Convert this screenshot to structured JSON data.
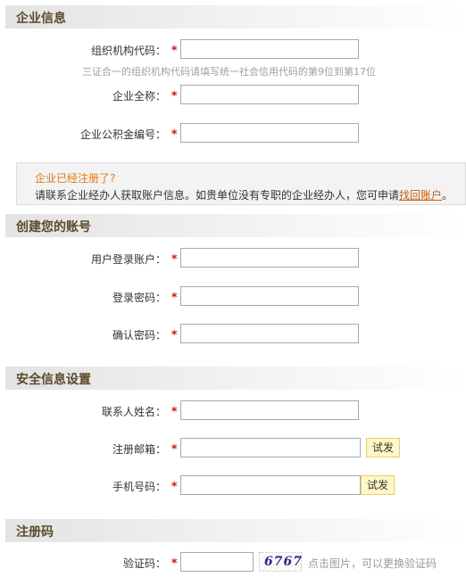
{
  "sections": {
    "company": "企业信息",
    "account": "创建您的账号",
    "security": "安全信息设置",
    "regcode": "注册码"
  },
  "fields": {
    "org_code": {
      "label": "组织机构代码：",
      "value": ""
    },
    "org_code_hint": "三证合一的组织机构代码请填写统一社会信用代码的第9位到第17位",
    "company_name": {
      "label": "企业全称：",
      "value": ""
    },
    "fund_number": {
      "label": "企业公积金编号：",
      "value": ""
    },
    "login_account": {
      "label": "用户登录账户：",
      "value": ""
    },
    "login_password": {
      "label": "登录密码：",
      "value": ""
    },
    "confirm_password": {
      "label": "确认密码：",
      "value": ""
    },
    "contact_name": {
      "label": "联系人姓名：",
      "value": ""
    },
    "email": {
      "label": "注册邮箱：",
      "value": ""
    },
    "phone": {
      "label": "手机号码：",
      "value": ""
    },
    "verify_code": {
      "label": "验证码：",
      "value": ""
    }
  },
  "required_mark": "*",
  "notice": {
    "question": "企业已经注册了?",
    "message": "请联系企业经办人获取账户信息。如贵单位没有专职的企业经办人，您可申请",
    "link": "找回账户",
    "tail": "。"
  },
  "buttons": {
    "email_send": "试发",
    "phone_send": "试发"
  },
  "captcha": {
    "text": "6767",
    "hint": "点击图片，可以更换验证码"
  }
}
